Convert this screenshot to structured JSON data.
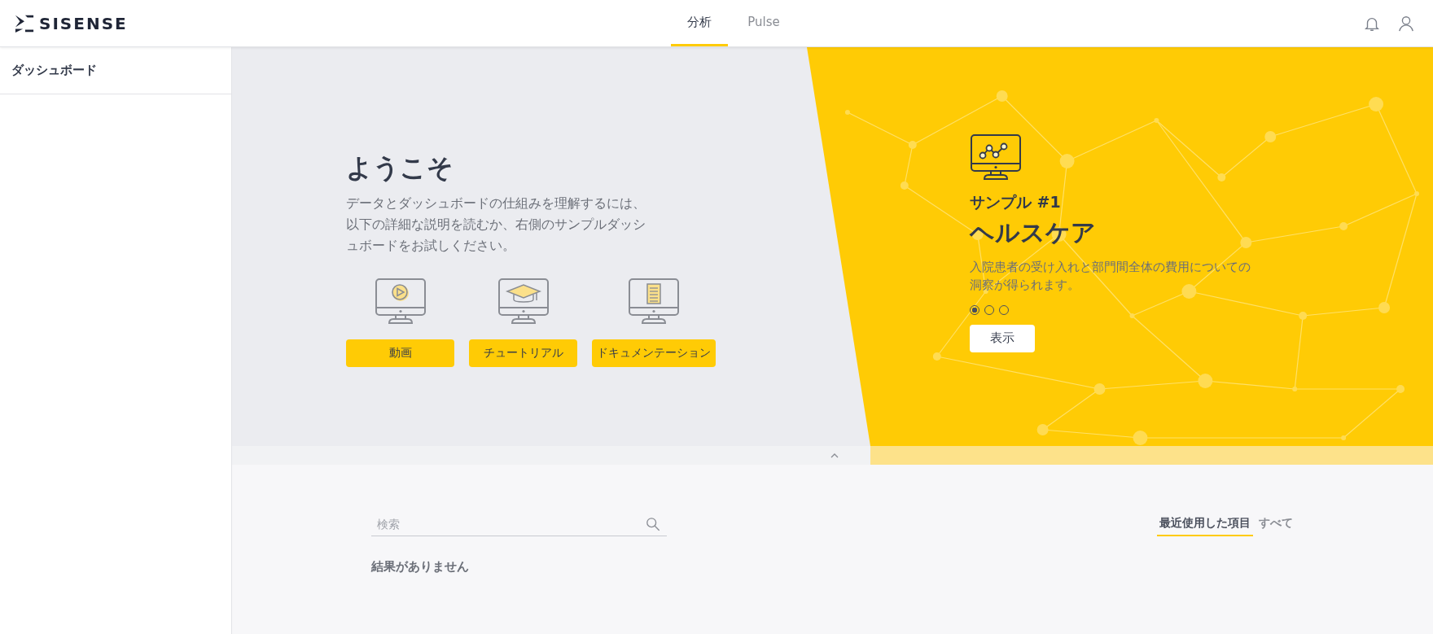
{
  "header": {
    "logo_text": "SISENSE",
    "tabs": [
      {
        "label": "分析",
        "selected": true
      },
      {
        "label": "Pulse",
        "selected": false
      }
    ]
  },
  "sidebar": {
    "items": [
      {
        "label": "ダッシュボード"
      }
    ]
  },
  "welcome": {
    "title": "ようこそ",
    "description": "データとダッシュボードの仕組みを理解するには、以下の詳細な説明を読むか、右側のサンプルダッシュボードをお試しください。",
    "resources": [
      {
        "kind": "video",
        "label": "動画"
      },
      {
        "kind": "tutorial",
        "label": "チュートリアル"
      },
      {
        "kind": "docs",
        "label": "ドキュメンテーション"
      }
    ]
  },
  "sample": {
    "eyebrow": "サンプル #1",
    "title": "ヘルスケア",
    "description": "入院患者の受け入れと部門間全体の費用についての洞察が得られます。",
    "dots": [
      {
        "selected": true
      },
      {
        "selected": false
      },
      {
        "selected": false
      }
    ],
    "button": "表示"
  },
  "search": {
    "placeholder": "検索"
  },
  "filter_tabs": [
    {
      "label": "最近使用した項目",
      "selected": true
    },
    {
      "label": "すべて",
      "selected": false
    }
  ],
  "empty_message": "結果がありません"
}
